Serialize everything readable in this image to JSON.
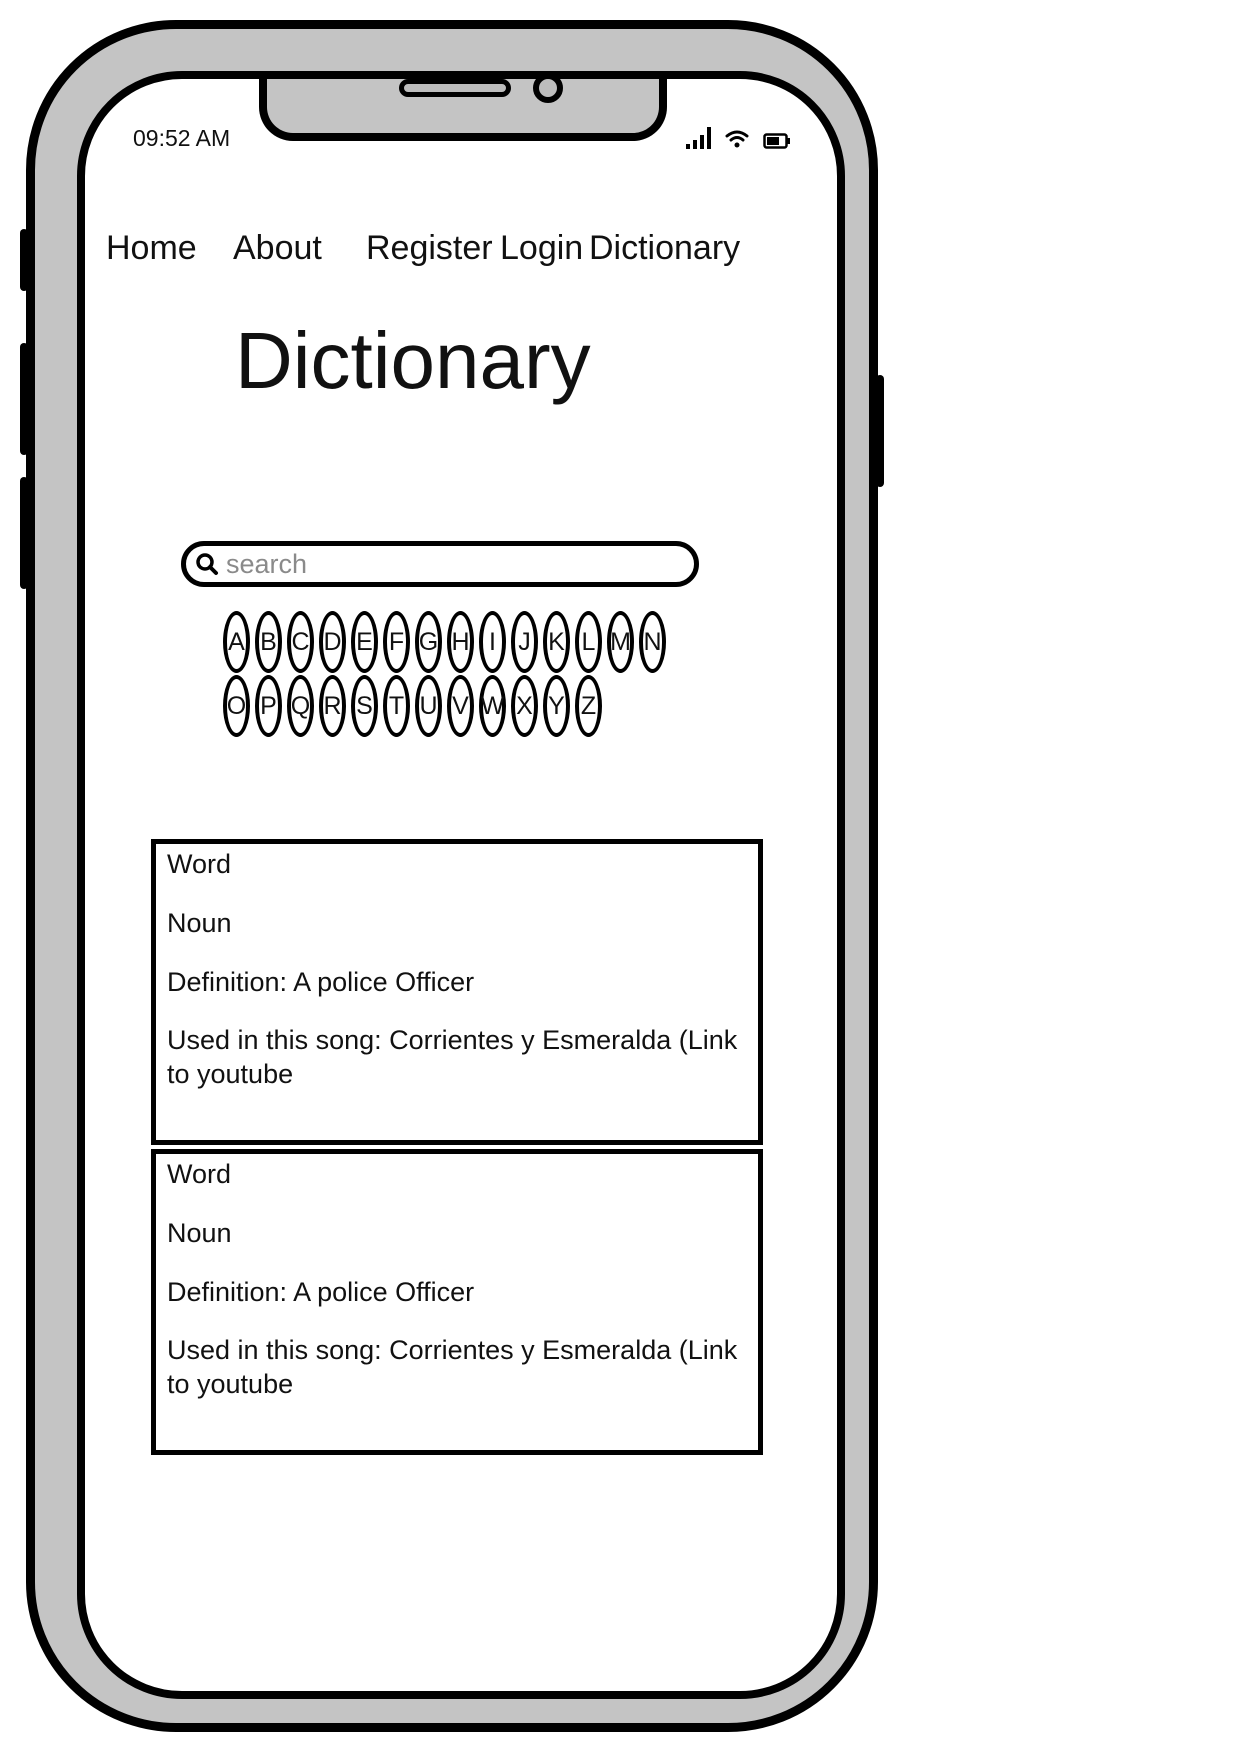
{
  "status": {
    "time": "09:52 AM"
  },
  "nav": {
    "items": [
      "Home",
      "About",
      "Register",
      "Login",
      "Dictionary"
    ]
  },
  "page": {
    "title": "Dictionary"
  },
  "search": {
    "placeholder": "search",
    "value": ""
  },
  "letters": {
    "row1": [
      "A",
      "B",
      "C",
      "D",
      "E",
      "F",
      "G",
      "H",
      "I",
      "J",
      "K",
      "L",
      "M",
      "N"
    ],
    "row2": [
      "O",
      "P",
      "Q",
      "R",
      "S",
      "T",
      "U",
      "V",
      "W",
      "X",
      "Y",
      "Z"
    ]
  },
  "entries": [
    {
      "word": "Word",
      "type": "Noun",
      "definition": "Definition: A police Officer",
      "song": "Used in this song: Corrientes y Esmeralda (Link to youtube"
    },
    {
      "word": "Word",
      "type": "Noun",
      "definition": "Definition: A police Officer",
      "song": "Used in this song: Corrientes y Esmeralda (Link to youtube"
    }
  ],
  "colors": {
    "frame": "#c4c4c4",
    "outline": "#000000",
    "screen": "#ffffff"
  }
}
